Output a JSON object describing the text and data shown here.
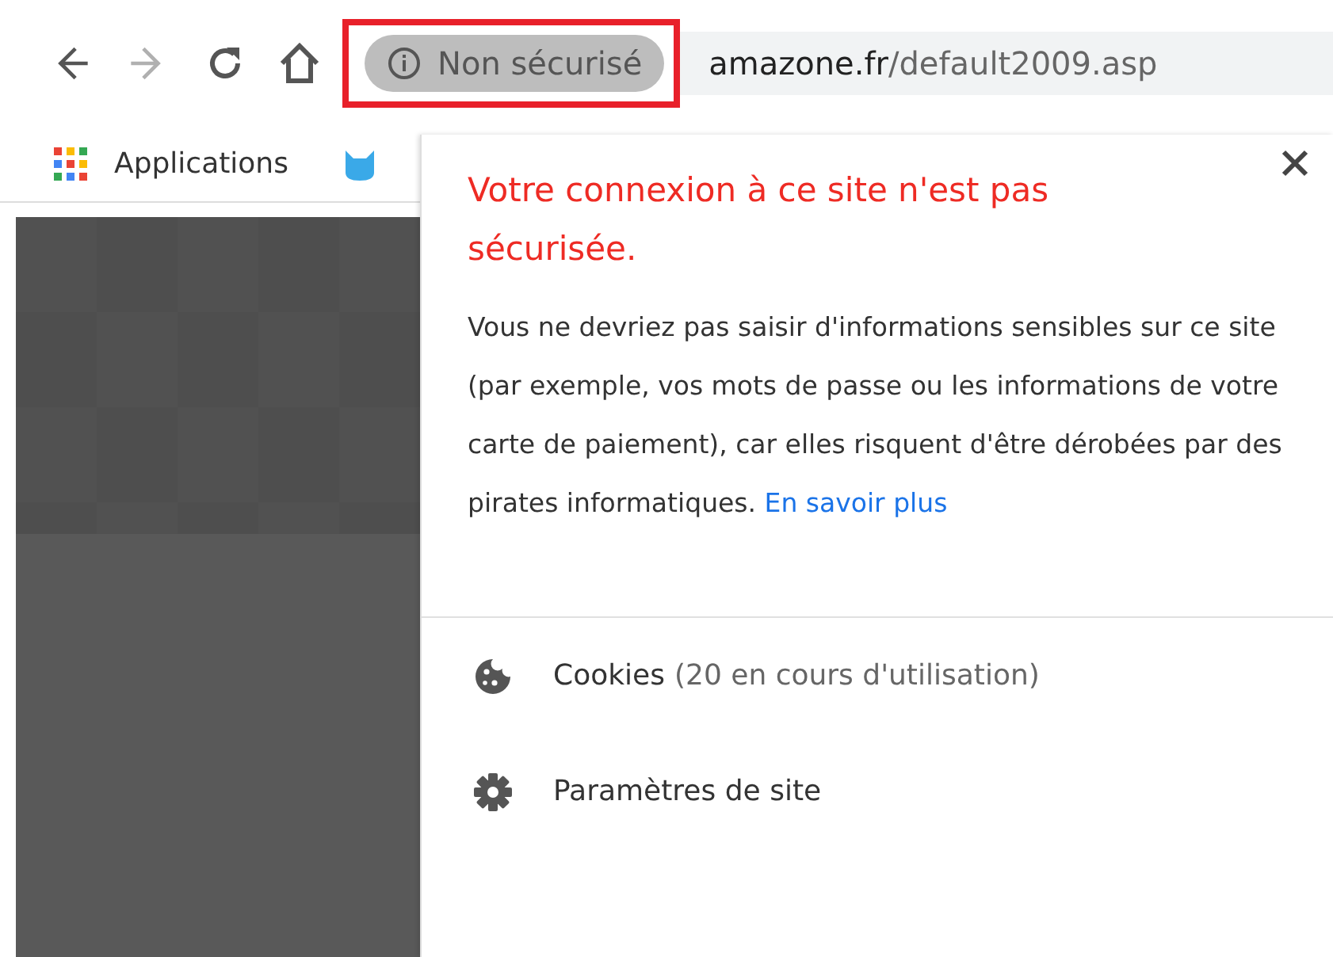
{
  "toolbar": {
    "back": {
      "disabled": false
    },
    "forward": {
      "disabled": true
    },
    "security_chip": {
      "label": "Non sécurisé",
      "highlighted": true
    },
    "url": {
      "domain": "amazone.fr",
      "path": "/default2009.asp"
    }
  },
  "bookmarks_bar": {
    "items": [
      {
        "kind": "apps",
        "label": "Applications"
      },
      {
        "kind": "favicon"
      }
    ]
  },
  "site_info_popup": {
    "title": "Votre connexion à ce site n'est pas sécurisée.",
    "body": "Vous ne devriez pas saisir d'informations sensibles sur ce site (par exemple, vos mots de passe ou les informations de votre carte de paiement), car elles risquent d'être dérobées par des pirates informatiques.",
    "link": "En savoir plus",
    "items": [
      {
        "kind": "cookies",
        "label": "Cookies",
        "detail": "(20 en cours d'utilisation)"
      },
      {
        "kind": "settings",
        "label": "Paramètres de site"
      }
    ]
  }
}
